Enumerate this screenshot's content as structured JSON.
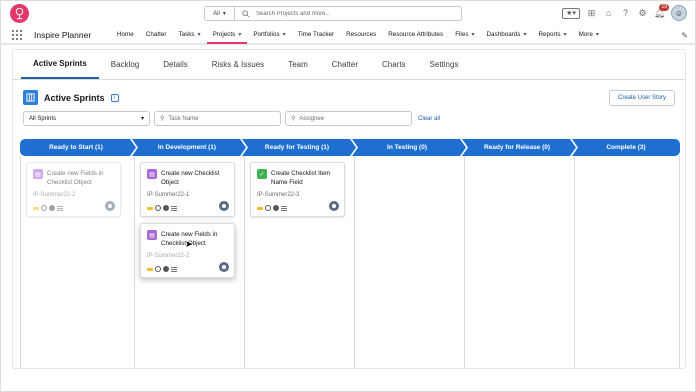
{
  "app": {
    "name": "Inspire Planner",
    "brand_color": "#e4386c",
    "accent_color": "#1f6fd1"
  },
  "search": {
    "scope": "All",
    "placeholder": "Search Projects and more..."
  },
  "header_icons": {
    "notifications_count": "19"
  },
  "nav": {
    "items": [
      {
        "label": "Home",
        "chevron": false
      },
      {
        "label": "Chatter",
        "chevron": false
      },
      {
        "label": "Tasks",
        "chevron": true
      },
      {
        "label": "Projects",
        "chevron": true,
        "active": true
      },
      {
        "label": "Portfolios",
        "chevron": true
      },
      {
        "label": "Time Tracker",
        "chevron": false
      },
      {
        "label": "Resources",
        "chevron": false
      },
      {
        "label": "Resource Attributes",
        "chevron": false
      },
      {
        "label": "Files",
        "chevron": true
      },
      {
        "label": "Dashboards",
        "chevron": true
      },
      {
        "label": "Reports",
        "chevron": true
      },
      {
        "label": "More",
        "chevron": true
      }
    ]
  },
  "tabs": [
    "Active Sprints",
    "Backlog",
    "Details",
    "Risks & Issues",
    "Team",
    "Chatter",
    "Charts",
    "Settings"
  ],
  "active_tab": "Active Sprints",
  "page": {
    "title": "Active Sprints",
    "create_button": "Create User Story"
  },
  "filters": {
    "sprint_select": "All Sprints",
    "task_placeholder": "Task Name",
    "assignee_placeholder": "Assignee",
    "clear_all": "Clear all"
  },
  "stages": [
    {
      "label": "Ready to Start  (1)"
    },
    {
      "label": "In Development  (1)"
    },
    {
      "label": "Ready for Testing  (1)"
    },
    {
      "label": "In Testing  (0)"
    },
    {
      "label": "Ready for Release  (0)"
    },
    {
      "label": "Complete  (3)"
    }
  ],
  "cards": [
    {
      "title": "Create new Fields in Checklist Object",
      "id": "IP-Summer22-2",
      "icon": "user-story-icon",
      "state": "faded"
    },
    {
      "title": "Create new Checklist Object",
      "id": "IP-Summer22-1",
      "icon": "user-story-icon",
      "state": "normal"
    },
    {
      "title": "Create Checklist Item Name Field",
      "id": "IP-Summer22-3",
      "icon": "checkmark-icon",
      "state": "normal"
    },
    {
      "title": "Create new Fields in Checklist Object",
      "id": "IP-Summer22-2",
      "icon": "user-story-icon",
      "state": "dragging"
    }
  ]
}
